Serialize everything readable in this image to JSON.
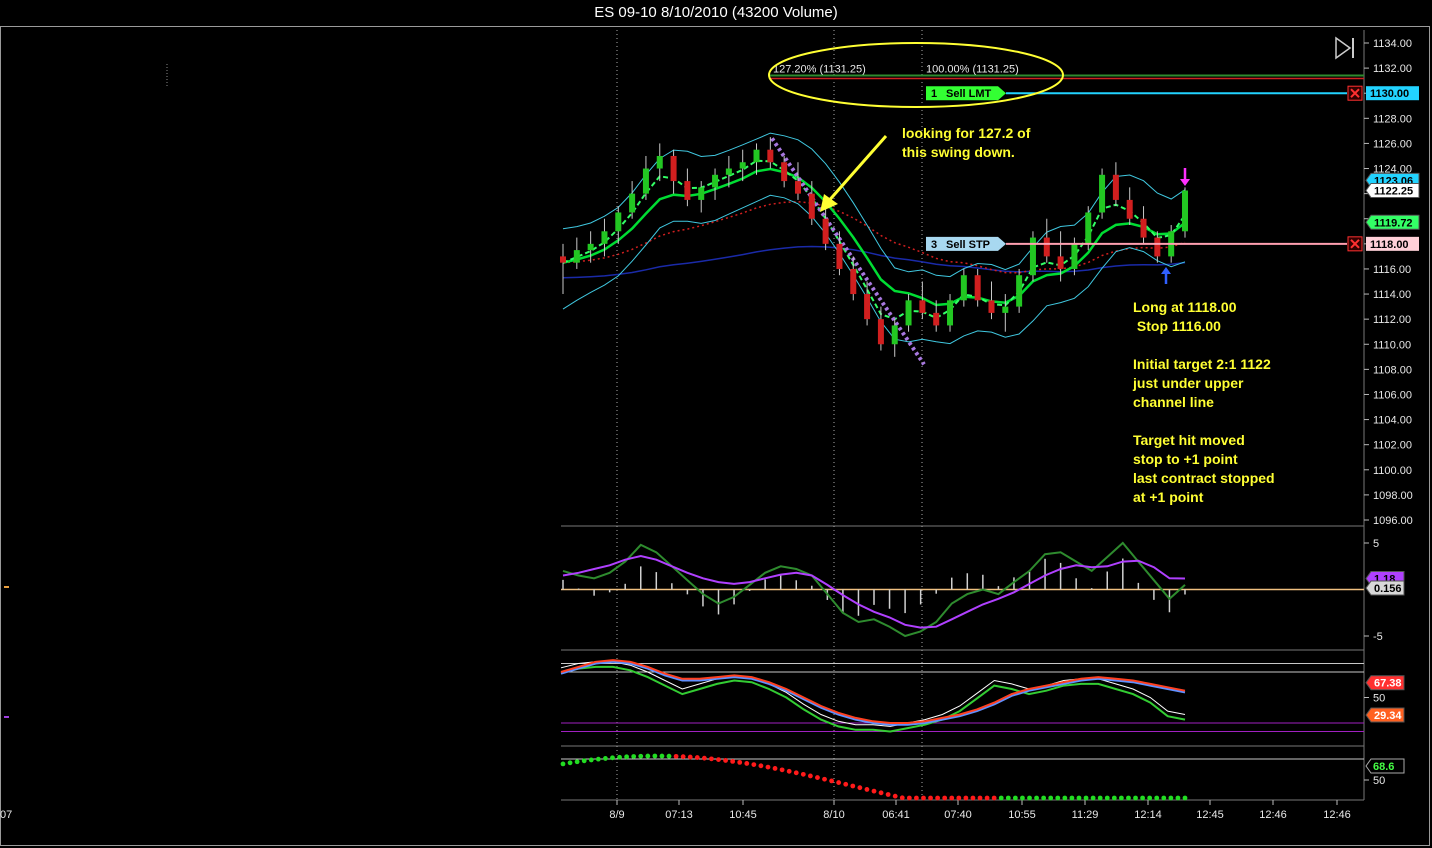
{
  "window": {
    "title": "ES 09-10  8/10/2010 (43200 Volume)"
  },
  "chart_data": [
    {
      "type": "candlestick",
      "panel": "price",
      "ylim": [
        1096,
        1134
      ],
      "y_ticks": [
        "1134.00",
        "1132.00",
        "1130.00",
        "1128.00",
        "1126.00",
        "1124.00",
        "1122.00",
        "1120.00",
        "1118.00",
        "1116.00",
        "1114.00",
        "1112.00",
        "1110.00",
        "1108.00",
        "1106.00",
        "1104.00",
        "1102.00",
        "1100.00",
        "1098.00",
        "1096.00"
      ],
      "x_ticks": [
        "8/9",
        "07:13",
        "10:45",
        "8/10",
        "06:41",
        "07:40",
        "10:55",
        "11:29",
        "12:14",
        "12:45",
        "12:46",
        "12:46"
      ],
      "left_edge_tick": "07",
      "candles": [
        [
          1117,
          1118,
          1114,
          1116.5
        ],
        [
          1116.5,
          1118.5,
          1116,
          1117.5
        ],
        [
          1117.5,
          1119,
          1116.5,
          1118
        ],
        [
          1118,
          1120,
          1117,
          1119
        ],
        [
          1119,
          1121,
          1118,
          1120.5
        ],
        [
          1120.5,
          1123,
          1120,
          1122
        ],
        [
          1122,
          1125,
          1121.5,
          1124
        ],
        [
          1124,
          1126,
          1123,
          1125
        ],
        [
          1125,
          1125.5,
          1122,
          1123
        ],
        [
          1123,
          1124,
          1121,
          1121.5
        ],
        [
          1121.5,
          1123,
          1120.5,
          1122.5
        ],
        [
          1122.5,
          1124,
          1121.5,
          1123.5
        ],
        [
          1123.5,
          1125,
          1122.5,
          1124
        ],
        [
          1124,
          1125.5,
          1123,
          1124.5
        ],
        [
          1124.5,
          1126,
          1123.5,
          1125.5
        ],
        [
          1125.5,
          1126.5,
          1124,
          1124.5
        ],
        [
          1124.5,
          1125,
          1122.5,
          1123
        ],
        [
          1123,
          1124.5,
          1121.5,
          1122
        ],
        [
          1122,
          1123,
          1119.5,
          1120
        ],
        [
          1120,
          1121,
          1117.5,
          1118
        ],
        [
          1118,
          1119,
          1115.5,
          1116
        ],
        [
          1116,
          1117,
          1113.5,
          1114
        ],
        [
          1114,
          1115,
          1111.5,
          1112
        ],
        [
          1112,
          1113,
          1109.5,
          1110
        ],
        [
          1110,
          1112,
          1109,
          1111.5
        ],
        [
          1111.5,
          1114,
          1111,
          1113.5
        ],
        [
          1113.5,
          1115,
          1112,
          1112.5
        ],
        [
          1112.5,
          1113.5,
          1111,
          1111.5
        ],
        [
          1111.5,
          1114,
          1111,
          1113.5
        ],
        [
          1113.5,
          1116,
          1113,
          1115.5
        ],
        [
          1115.5,
          1116,
          1113,
          1113.5
        ],
        [
          1113.5,
          1115,
          1112,
          1112.5
        ],
        [
          1112.5,
          1114,
          1111,
          1113
        ],
        [
          1113,
          1116,
          1112.5,
          1115.5
        ],
        [
          1115.5,
          1119,
          1115,
          1118.5
        ],
        [
          1118.5,
          1120,
          1116.5,
          1117
        ],
        [
          1117,
          1119,
          1115,
          1116
        ],
        [
          1116,
          1118.5,
          1115.5,
          1118
        ],
        [
          1118,
          1121,
          1117.5,
          1120.5
        ],
        [
          1120.5,
          1124,
          1120,
          1123.5
        ],
        [
          1123.5,
          1124.5,
          1121,
          1121.5
        ],
        [
          1121.5,
          1122.5,
          1119.5,
          1120
        ],
        [
          1120,
          1121,
          1118,
          1118.5
        ],
        [
          1118.5,
          1119,
          1116.5,
          1117
        ],
        [
          1117,
          1119.5,
          1116.5,
          1119
        ],
        [
          1119,
          1122.5,
          1118.5,
          1122.25
        ]
      ],
      "fib_levels": [
        {
          "label": "127.20% (1131.25)",
          "value": 1131.25,
          "color": "#2e8b2e"
        },
        {
          "label": "100.00% (1131.25)",
          "value": 1131.25,
          "color": "#cc2222"
        }
      ],
      "orders": [
        {
          "id": "1",
          "label": "Sell LMT",
          "price": 1130,
          "price_label": "1130.00",
          "color": "#33ff33",
          "line_color": "#22d3ff"
        },
        {
          "id": "3",
          "label": "Sell STP",
          "price": 1118,
          "price_label": "1118.00",
          "color": "#a8d8f0",
          "line_color": "#ff9fb0"
        }
      ],
      "price_tags": [
        {
          "label": "1123.06",
          "value": 1123.06,
          "color": "#22d3ff"
        },
        {
          "label": "1122.25",
          "value": 1122.25,
          "color": "#ffffff"
        },
        {
          "label": "1119.72",
          "value": 1119.72,
          "color": "#33ff66"
        },
        {
          "label": "1118.00",
          "value": 1118.0,
          "color": "#ffd0d8"
        }
      ],
      "annotations": [
        {
          "text": [
            "looking for 127.2 of",
            "this swing down."
          ]
        },
        {
          "text": [
            "Long at 1118.00",
            " Stop 1116.00",
            "",
            "Initial target  2:1 1122",
            "just under upper",
            "channel line",
            "",
            " Target hit moved",
            "stop to +1 point",
            "last contract stopped",
            "at +1 point"
          ]
        }
      ],
      "colors": {
        "up": "#22c722",
        "down": "#d11f1f",
        "channel": "#40c8e0",
        "fast_ma": "#33ff66",
        "slow_ma": "#00dd33",
        "annotation": "#ffff33"
      }
    },
    {
      "type": "macd",
      "panel": "oscillator",
      "ylim": [
        -6,
        6
      ],
      "y_ticks": [
        "5",
        "-5"
      ],
      "tags": [
        {
          "label": "1.18",
          "value": 1.18,
          "color": "#b040ff"
        },
        {
          "label": "0.156",
          "value": 0.156,
          "color": "#d8d8d8"
        }
      ],
      "macd": [
        2,
        1.5,
        1.2,
        1.8,
        3,
        4.8,
        4,
        2.5,
        1,
        -0.5,
        -1.5,
        -0.8,
        0.5,
        1.8,
        2.5,
        2.2,
        1.5,
        -0.5,
        -2.5,
        -3.5,
        -3.2,
        -4,
        -5,
        -4.5,
        -3.5,
        -1.5,
        -0.5,
        0,
        -0.5,
        0.8,
        2,
        3.8,
        4,
        3,
        2,
        3.5,
        5,
        3,
        1,
        -1,
        0.5
      ],
      "signal": [
        1.5,
        1.8,
        2.2,
        2.6,
        3.2,
        3.6,
        3.2,
        2.5,
        1.8,
        1.2,
        0.8,
        0.6,
        0.8,
        1.2,
        1.6,
        1.8,
        1.5,
        0.5,
        -0.6,
        -1.6,
        -2.4,
        -3,
        -3.8,
        -4.1,
        -4.0,
        -3.2,
        -2.4,
        -1.6,
        -1,
        -0.3,
        0.6,
        1.5,
        2.2,
        2.6,
        2.4,
        2.5,
        3,
        3.1,
        2.4,
        1.2,
        1.18
      ]
    },
    {
      "type": "stochastic",
      "panel": "oscillator",
      "ylim": [
        0,
        100
      ],
      "y_ticks": [
        "50"
      ],
      "tags": [
        {
          "label": "67.38",
          "value": 67.38,
          "color": "#ff3030"
        },
        {
          "label": "29.34",
          "value": 29.34,
          "color": "#ff6020"
        }
      ],
      "series_a": [
        85,
        90,
        92,
        92,
        88,
        80,
        70,
        60,
        66,
        72,
        76,
        74,
        66,
        56,
        42,
        30,
        22,
        18,
        18,
        16,
        20,
        24,
        30,
        40,
        55,
        70,
        66,
        60,
        64,
        70,
        72,
        72,
        66,
        60,
        50,
        34,
        30
      ],
      "series_b": [
        78,
        84,
        90,
        92,
        90,
        84,
        76,
        70,
        70,
        72,
        74,
        72,
        66,
        58,
        48,
        38,
        30,
        24,
        20,
        18,
        18,
        20,
        24,
        28,
        34,
        42,
        52,
        58,
        62,
        66,
        70,
        72,
        70,
        68,
        64,
        60,
        56
      ]
    },
    {
      "type": "dots",
      "panel": "cycle",
      "ylim": [
        0,
        100
      ],
      "y_ticks": [
        "50"
      ],
      "tags": [
        {
          "label": "68.6",
          "value": 68.6,
          "color": "#44ff44"
        }
      ]
    }
  ]
}
